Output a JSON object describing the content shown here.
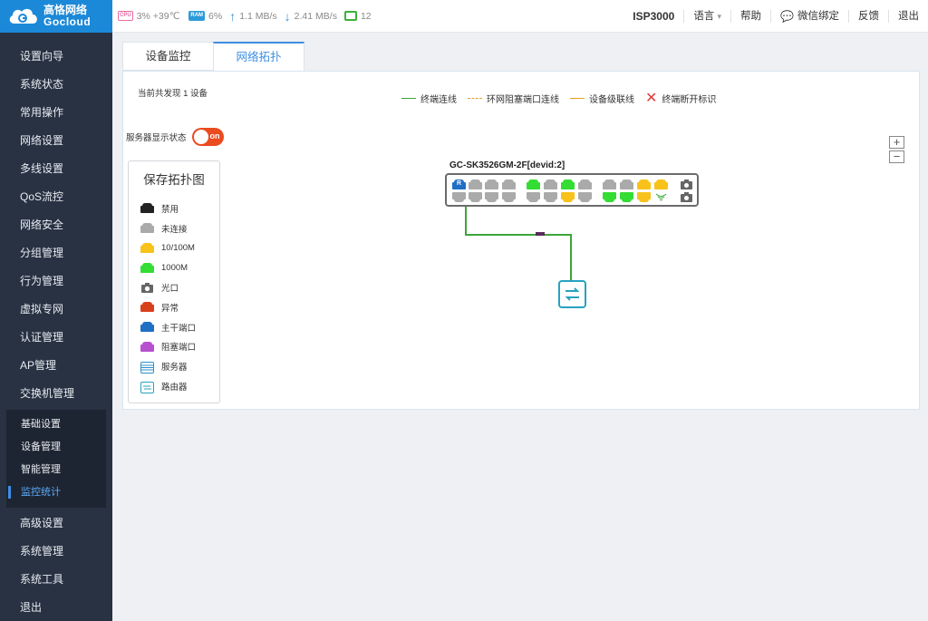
{
  "brand": {
    "cn": "高恪网络",
    "en": "Gocloud"
  },
  "status": {
    "cpu_chip": "CPU",
    "cpu": "3% +39℃",
    "ram_chip": "RAM",
    "ram": "6%",
    "upload": "1.1 MB/s",
    "download": "2.41 MB/s",
    "online": "12"
  },
  "topnav": {
    "model": "ISP3000",
    "lang": "语言",
    "lang_caret": "▾",
    "help": "帮助",
    "wechat": "微信绑定",
    "feedback": "反馈",
    "logout": "退出"
  },
  "menu": [
    "设置向导",
    "系统状态",
    "常用操作",
    "网络设置",
    "多线设置",
    "QoS流控",
    "网络安全",
    "分组管理",
    "行为管理",
    "虚拟专网",
    "认证管理",
    "AP管理",
    "交换机管理"
  ],
  "submenu": [
    "基础设置",
    "设备管理",
    "智能管理",
    "监控统计"
  ],
  "menu_bottom": [
    "高级设置",
    "系统管理",
    "系统工具",
    "退出"
  ],
  "tabs": [
    "设备监控",
    "网络拓扑"
  ],
  "panel": {
    "count_text": "当前共发现 1 设备",
    "legend": [
      "终端连线",
      "环网阻塞端口连线",
      "设备级联线",
      "终端断开标识"
    ],
    "legend_x": "✕",
    "server_label": "服务器显示状态",
    "toggle_text": "on",
    "zoom_in": "+",
    "zoom_out": "−",
    "key_title": "保存拓扑图",
    "key": [
      "禁用",
      "未连接",
      "10/100M",
      "1000M",
      "光口",
      "异常",
      "主干端口",
      "阻塞端口",
      "服务器",
      "路由器"
    ],
    "device_title": "GC-SK3526GM-2F[devid:2]",
    "port_label": "R"
  },
  "colors": {
    "accent": "#3d8fe0",
    "sidebar": "#283243",
    "logo_bg": "#1c89d8",
    "disabled": "#222222",
    "unconnected": "#aaaaaa",
    "fast": "#f8c21a",
    "gigabit": "#33dd33",
    "error": "#d8401c",
    "trunk": "#1f6fc4",
    "blocked": "#b84fcf",
    "router": "#27a2c0",
    "link": "#3aa63a"
  }
}
